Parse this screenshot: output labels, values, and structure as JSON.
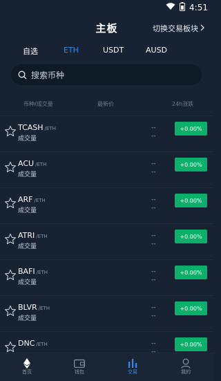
{
  "status_bar": {
    "time": "4:51",
    "icons": [
      "wifi-icon",
      "battery-icon"
    ]
  },
  "header": {
    "title": "主板",
    "switch_label": "切换交易板块",
    "switch_icon": "chevron-right-icon"
  },
  "tabs": [
    {
      "label": "自选",
      "active": false
    },
    {
      "label": "ETH",
      "active": true
    },
    {
      "label": "USDT",
      "active": false
    },
    {
      "label": "AUSD",
      "active": false
    }
  ],
  "search": {
    "placeholder": "搜索币种",
    "icon": "search-icon"
  },
  "columns": {
    "pair": "币种/成交量",
    "price": "最新价",
    "change": "24h涨跌"
  },
  "rows": [
    {
      "symbol": "TCASH",
      "quote": "/ETH",
      "volume_label": "成交量",
      "price": "--\n--",
      "change": "+0.00%"
    },
    {
      "symbol": "ACU",
      "quote": "/ETH",
      "volume_label": "成交量",
      "price": "--\n--",
      "change": "+0.00%"
    },
    {
      "symbol": "ARF",
      "quote": "/ETH",
      "volume_label": "成交量",
      "price": "--\n--",
      "change": "+0.00%"
    },
    {
      "symbol": "ATRI",
      "quote": "/ETH",
      "volume_label": "成交量",
      "price": "--\n--",
      "change": "+0.00%"
    },
    {
      "symbol": "BAFI",
      "quote": "/ETH",
      "volume_label": "成交量",
      "price": "--\n--",
      "change": "+0.00%"
    },
    {
      "symbol": "BLVR",
      "quote": "/ETH",
      "volume_label": "成交量",
      "price": "--\n--",
      "change": "+0.00%"
    },
    {
      "symbol": "DNC",
      "quote": "/ETH",
      "volume_label": "",
      "price": "--\n--",
      "change": "+0.00%"
    }
  ],
  "bottom_nav": [
    {
      "label": "首页",
      "icon": "eth-home-icon",
      "active": false
    },
    {
      "label": "钱包",
      "icon": "wallet-icon",
      "active": false
    },
    {
      "label": "交易",
      "icon": "bar-chart-icon",
      "active": true
    },
    {
      "label": "我的",
      "icon": "user-icon",
      "active": false
    }
  ],
  "colors": {
    "background": "#172233",
    "accent": "#2d8cf0",
    "positive": "#0db06a"
  }
}
